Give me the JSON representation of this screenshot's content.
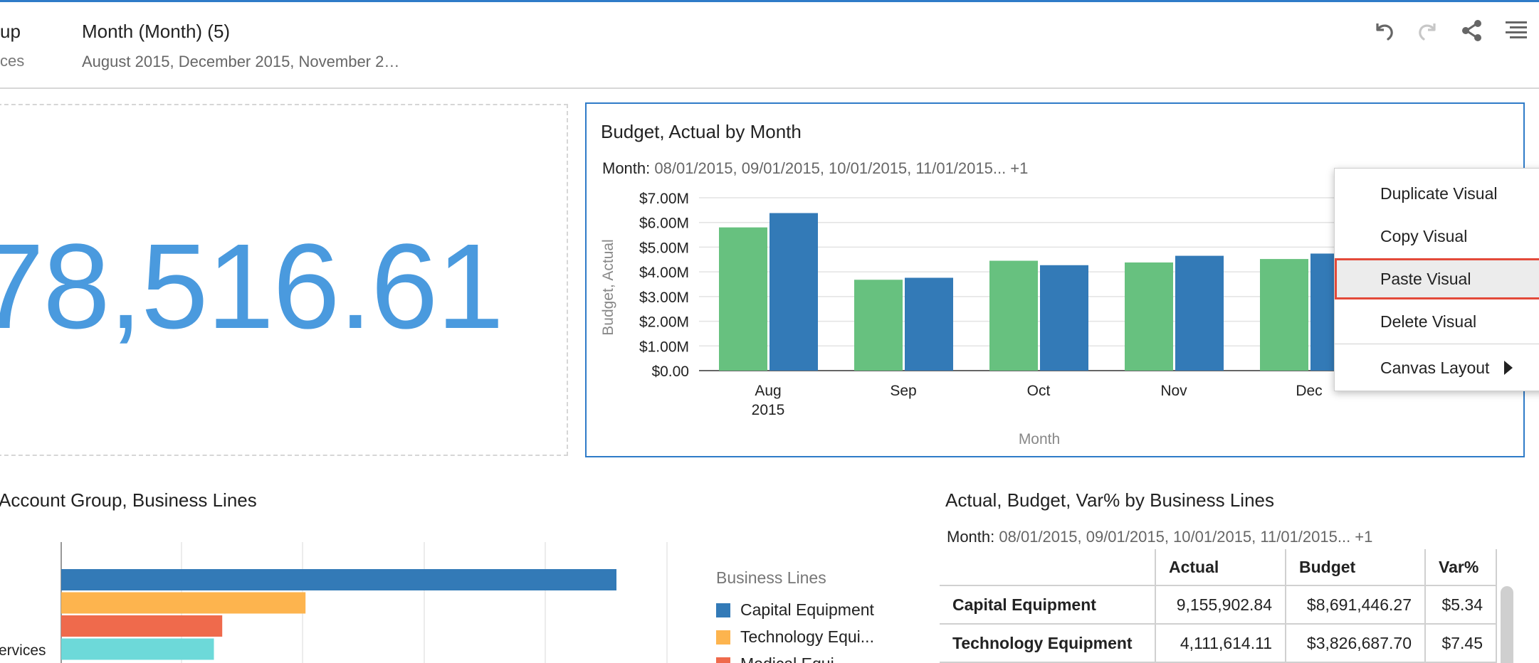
{
  "header": {
    "left_filter": {
      "title": "up",
      "value": "ces"
    },
    "month_filter": {
      "title": "Month (Month) (5)",
      "value": "August 2015, December 2015, November 2…"
    },
    "toolbar": [
      {
        "name": "undo-icon"
      },
      {
        "name": "redo-icon"
      },
      {
        "name": "share-icon"
      },
      {
        "name": "menu-icon"
      }
    ]
  },
  "kpi": {
    "value": "78,516.61"
  },
  "bar_chart": {
    "title": "Budget, Actual by Month",
    "filter_label": "Month:",
    "filter_values": "08/01/2015, 09/01/2015, 10/01/2015, 11/01/2015... +1"
  },
  "chart_data": {
    "type": "bar",
    "title": "Budget, Actual by Month",
    "xlabel": "Month",
    "ylabel": "Budget, Actual",
    "ylim": [
      0,
      7000000
    ],
    "yticks": [
      "$0.00",
      "$1.00M",
      "$2.00M",
      "$3.00M",
      "$4.00M",
      "$5.00M",
      "$6.00M",
      "$7.00M"
    ],
    "categories": [
      "Aug|2015",
      "Sep",
      "Oct",
      "Nov",
      "Dec"
    ],
    "series": [
      {
        "values": [
          5800000,
          3680000,
          4450000,
          4380000,
          4520000
        ],
        "color": "#67c17f"
      },
      {
        "values": [
          6380000,
          3760000,
          4270000,
          4650000,
          4740000
        ],
        "color": "#337ab7"
      }
    ]
  },
  "context_menu": {
    "items": [
      {
        "label": "Duplicate Visual"
      },
      {
        "label": "Copy Visual"
      },
      {
        "label": "Paste Visual",
        "highlighted": true
      },
      {
        "label": "Delete Visual"
      },
      {
        "label": "Canvas Layout",
        "submenu": true
      }
    ]
  },
  "lower_left": {
    "title": "Account Group, Business Lines",
    "axis_label": "ervices",
    "legend_title": "Business Lines",
    "legend": [
      {
        "label": "Capital Equipment",
        "color": "#337ab7"
      },
      {
        "label": "Technology Equi...",
        "color": "#fdb44e"
      },
      {
        "label": "Medical Equi...",
        "color": "#ef6a4c"
      }
    ],
    "bars": [
      {
        "value": 100,
        "color": "#337ab7"
      },
      {
        "value": 44,
        "color": "#fdb44e"
      },
      {
        "value": 29,
        "color": "#ef6a4c"
      },
      {
        "value": 27.5,
        "color": "#6dd9d9"
      }
    ]
  },
  "lower_right": {
    "title": "Actual, Budget, Var% by Business Lines",
    "filter_label": "Month:",
    "filter_values": "08/01/2015, 09/01/2015, 10/01/2015, 11/01/2015... +1",
    "columns": [
      "",
      "Actual",
      "Budget",
      "Var%"
    ],
    "rows": [
      [
        "Capital Equipment",
        "9,155,902.84",
        "$8,691,446.27",
        "$5.34"
      ],
      [
        "Technology Equipment",
        "4,111,614.11",
        "$3,826,687.70",
        "$7.45"
      ]
    ]
  }
}
